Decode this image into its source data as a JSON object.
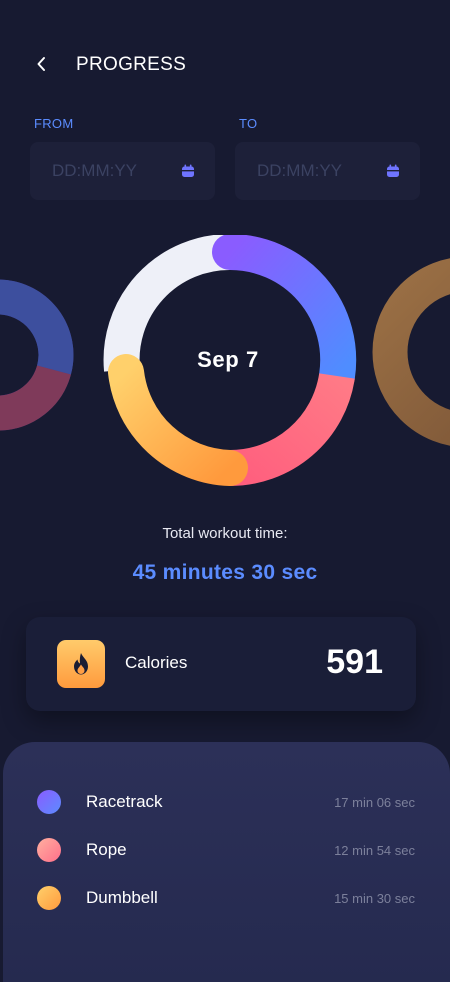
{
  "header": {
    "title": "PROGRESS"
  },
  "date_range": {
    "from_label": "FROM",
    "to_label": "TO",
    "from_placeholder": "DD:MM:YY",
    "to_placeholder": "DD:MM:YY"
  },
  "donut": {
    "center_label": "Sep 7",
    "segments": [
      {
        "name": "Racetrack",
        "fraction": 0.28,
        "colors": [
          "#8a5cff",
          "#5b8cff"
        ]
      },
      {
        "name": "Rope",
        "fraction": 0.22,
        "colors": [
          "#ff6f91",
          "#ff8a6a"
        ]
      },
      {
        "name": "Dumbbell",
        "fraction": 0.25,
        "colors": [
          "#ffcb6b",
          "#ff9a3d"
        ]
      },
      {
        "name": "remaining",
        "fraction": 0.25,
        "colors": [
          "#eef0f8",
          "#eef0f8"
        ]
      }
    ]
  },
  "summary": {
    "total_label": "Total workout time:",
    "total_value": "45 minutes 30 sec"
  },
  "calories": {
    "label": "Calories",
    "value": "591"
  },
  "activities": [
    {
      "name": "Racetrack",
      "time": "17 min 06 sec",
      "color": "#6f74ff"
    },
    {
      "name": "Rope",
      "time": "12 min 54 sec",
      "color": "#ff8f8f"
    },
    {
      "name": "Dumbbell",
      "time": "15 min 30 sec",
      "color": "#ffb057"
    }
  ],
  "colors": {
    "background": "#171a31",
    "accent": "#5b8cff",
    "panel": "#2a2e55"
  },
  "icons": [
    "chevron-left-icon",
    "calendar-icon",
    "flame-icon"
  ]
}
